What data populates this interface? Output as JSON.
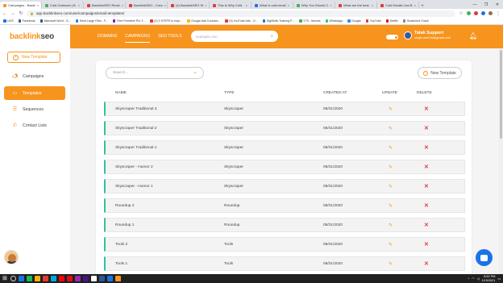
{
  "browser": {
    "tabs": [
      {
        "title": "Campaigns - Backl",
        "color": "#f7941d",
        "active": true
      },
      {
        "title": "Cold Outreach | B",
        "color": "#4caf50"
      },
      {
        "title": "BacklinkSEO Revie",
        "color": "#e53935"
      },
      {
        "title": "BacklinkSEO - Crea",
        "color": "#e53935"
      },
      {
        "title": "(4) BacklinkSEO St",
        "color": "#e53935"
      },
      {
        "title": "This Is Why Cold",
        "color": "#e53935"
      },
      {
        "title": "What is cold email",
        "color": "#1a73e8"
      },
      {
        "title": "Why You Should C",
        "color": "#4caf50"
      },
      {
        "title": "What are the best",
        "color": "#e53935"
      },
      {
        "title": "Cold Emails Can B",
        "color": "#e53935"
      }
    ],
    "new_tab": "+",
    "window_controls": [
      "—",
      "❐",
      "✕"
    ],
    "url": "app.backlinkseo.com/user/campaigns/email-templates/",
    "bookmarks": [
      {
        "label": "UCR",
        "color": "#1a73e8"
      },
      {
        "label": "Facebook",
        "color": "#3b5998"
      },
      {
        "label": "Microsoft Word - G...",
        "color": "#2b579a"
      },
      {
        "label": "Send Large Files - F...",
        "color": "#1e88e5"
      },
      {
        "label": "Free Premiere Pro T...",
        "color": "#7b1fa2"
      },
      {
        "label": "(2) 3 STEPS to Impr...",
        "color": "#e53935"
      },
      {
        "label": "Google Ads Courses...",
        "color": "#fbbc05"
      },
      {
        "label": "(9) YouTube Ads - G...",
        "color": "#e53935"
      },
      {
        "label": "DigiSkills Training P...",
        "color": "#1a73e8"
      },
      {
        "label": "YTS - Movies",
        "color": "#4caf50"
      },
      {
        "label": "WhatsApp",
        "color": "#25d366"
      },
      {
        "label": "Google",
        "color": "#4285f4"
      },
      {
        "label": "YouTube",
        "color": "#e53935"
      },
      {
        "label": "Netflix",
        "color": "#e50914"
      },
      {
        "label": "Scratched Chark",
        "color": "#888888"
      }
    ]
  },
  "header": {
    "logo_part1": "backlink",
    "logo_part2": "seo",
    "nav": [
      {
        "label": "Domains",
        "active": false
      },
      {
        "label": "Campaigns",
        "active": true
      },
      {
        "label": "SEO Tools",
        "active": false
      }
    ],
    "search_placeholder": "example.com",
    "user_name": "Talak Support",
    "user_email": "saqib.user16@gmail.com",
    "accent_color": "#f7941d"
  },
  "sidebar": {
    "new_template_label": "New Template",
    "items": [
      {
        "label": "Campaigns",
        "icon": "megaphone-icon",
        "active": false
      },
      {
        "label": "Templates",
        "icon": "folder-icon",
        "active": true
      },
      {
        "label": "Sequences",
        "icon": "stack-icon",
        "active": false
      },
      {
        "label": "Contact Lists",
        "icon": "phone-icon",
        "active": false
      }
    ]
  },
  "main": {
    "search_placeholder": "Search...",
    "new_template_label": "New Template",
    "columns": {
      "name": "Name",
      "type": "Type",
      "created": "Created At",
      "update": "Update",
      "delete": "Delete"
    },
    "rows": [
      {
        "name": "Skyscraper Traditional 3",
        "type": "Skyscraper",
        "created": "08/31/2020"
      },
      {
        "name": "Skyscraper Traditional 2",
        "type": "Skyscraper",
        "created": "08/31/2020"
      },
      {
        "name": "Skyscraper Traditional 1",
        "type": "Skyscraper",
        "created": "08/31/2020"
      },
      {
        "name": "Skyscraper - Humor 2",
        "type": "Skyscraper",
        "created": "08/31/2020"
      },
      {
        "name": "Skyscraper - Humor 1",
        "type": "Skyscraper",
        "created": "08/31/2020"
      },
      {
        "name": "Roundup 2",
        "type": "Roundup",
        "created": "08/31/2020"
      },
      {
        "name": "Roundup 1",
        "type": "Roundup",
        "created": "08/31/2020"
      },
      {
        "name": "Tools 2",
        "type": "Tools",
        "created": "08/31/2020"
      },
      {
        "name": "Tools 1",
        "type": "Tools",
        "created": "08/31/2020"
      }
    ],
    "row_accent_color": "#2ec4a0",
    "delete_color": "#e23b3b"
  },
  "taskbar": {
    "icons": [
      "#1a73e8",
      "#1db954",
      "#f4b400",
      "#e53935",
      "#00a8e1",
      "#ff0000",
      "#e50914",
      "#9c27b0",
      "#4a148c",
      "#ffffff",
      "#2b579a",
      "#1a73e8",
      "#f7941d"
    ],
    "time": "8:52 PM",
    "date": "1/15/2021"
  }
}
